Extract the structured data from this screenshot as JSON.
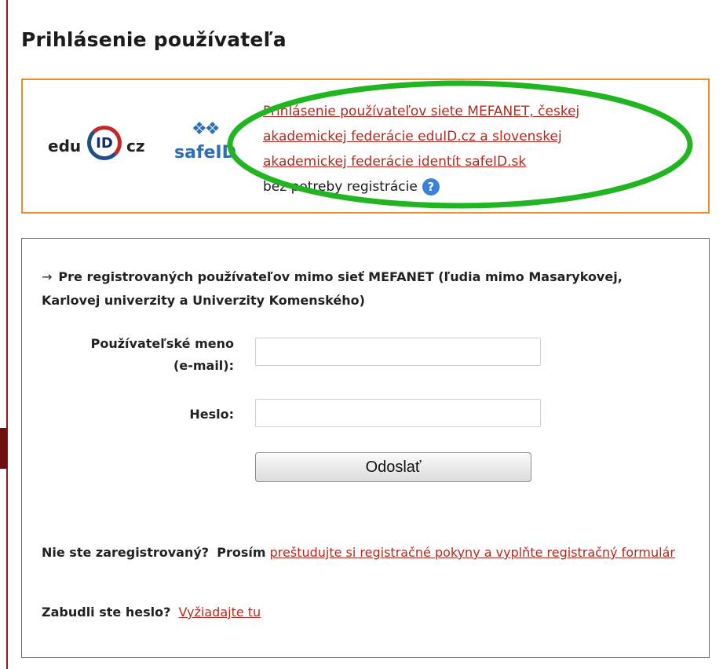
{
  "page": {
    "title": "Prihlásenie používateľa"
  },
  "federation": {
    "eduid_logo": {
      "pre": "edu",
      "mid": "ID",
      "post": "cz"
    },
    "safeid_logo": {
      "text": "safeID"
    },
    "link_lines": [
      "Prihlásenie používateľov siete MEFANET, českej",
      "akademickej federácie eduID.cz a slovenskej",
      "akademickej federácie identít safeID.sk"
    ],
    "no_registration_text": "bez potreby registrácie",
    "help_icon": "?",
    "highlight_color": "#22b522"
  },
  "registered": {
    "arrow": "→",
    "intro": "Pre registrovaných používateľov mimo sieť MEFANET (ľudia mimo Masarykovej, Karlovej univerzity a Univerzity Komenského)",
    "username_label_line1": "Používateľské meno",
    "username_label_line2": "(e-mail):",
    "username_value": "",
    "password_label": "Heslo:",
    "password_value": "",
    "submit_label": "Odoslať"
  },
  "footer": {
    "not_registered_q": "Nie ste zaregistrovaný?",
    "please": "Prosím",
    "register_link": "preštudujte si registračné pokyny a vyplňte registračný formulár",
    "forgot_q": "Zabudli ste heslo?",
    "forgot_link": "Vyžiadajte tu"
  },
  "colors": {
    "orange_border": "#f28c28",
    "red_border": "#c94050",
    "link": "#b22a1f"
  }
}
